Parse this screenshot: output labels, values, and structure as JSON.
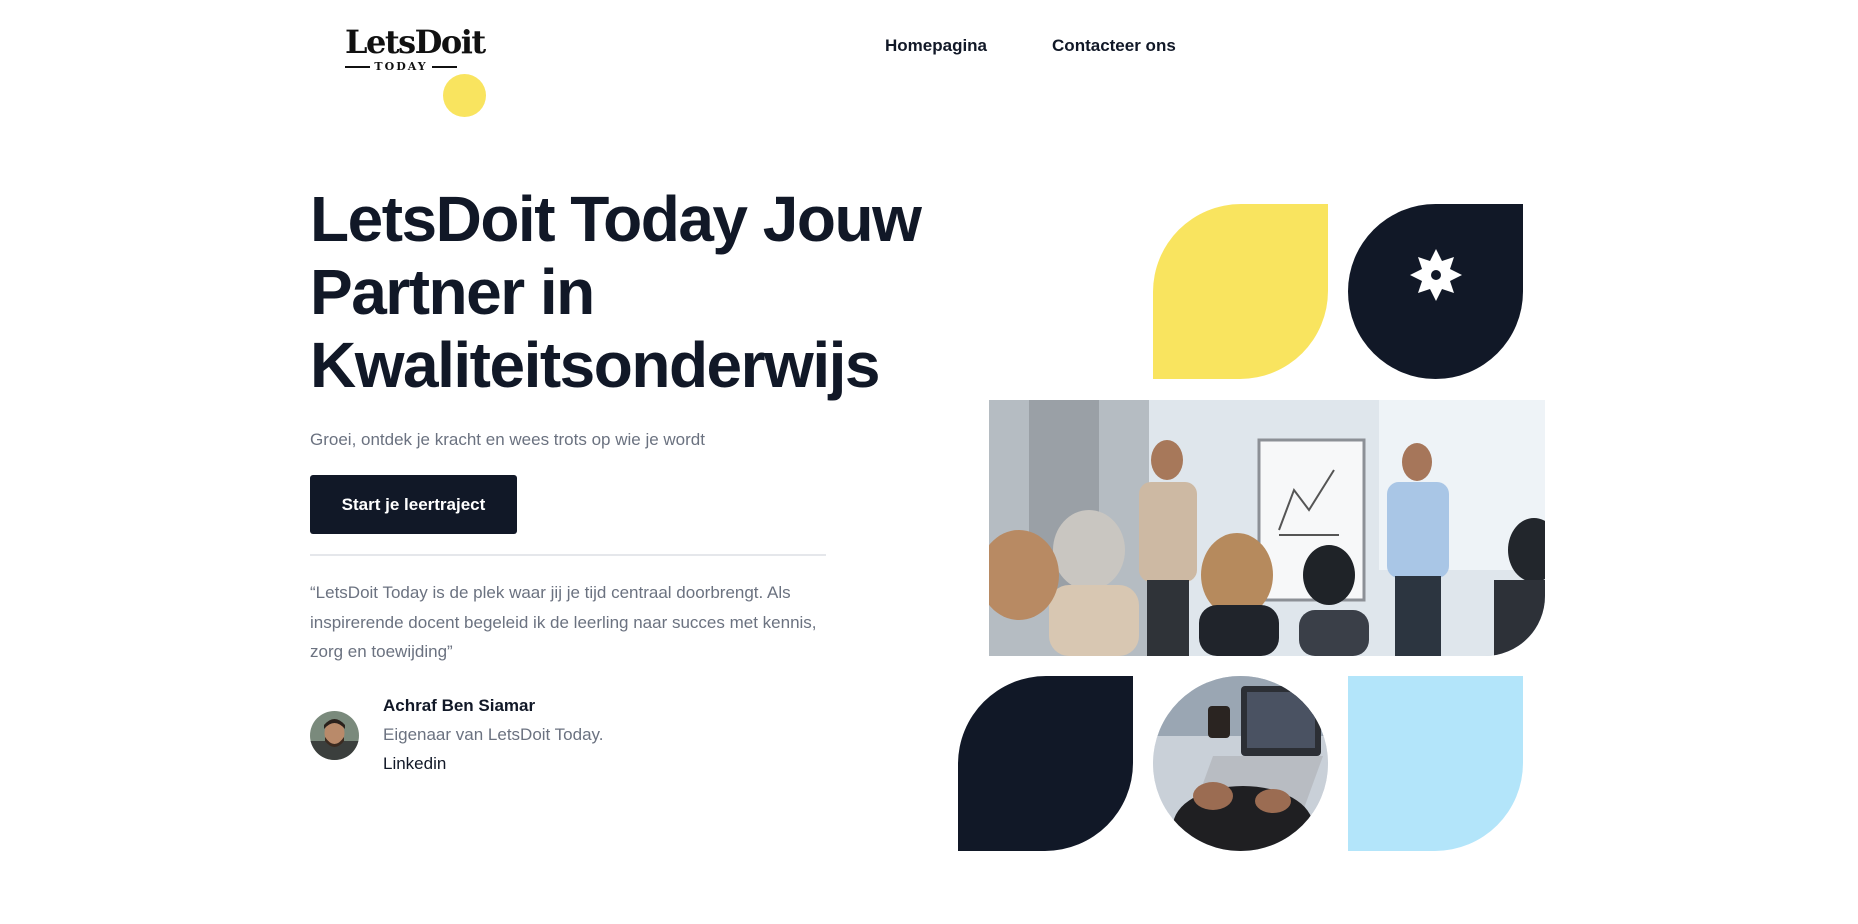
{
  "header": {
    "logo": {
      "word": "LetsDoit",
      "sub": "TODAY"
    },
    "nav": [
      {
        "label": "Homepagina"
      },
      {
        "label": "Contacteer ons"
      }
    ]
  },
  "hero": {
    "title": "LetsDoit Today Jouw Partner in Kwaliteitsonderwijs",
    "subtitle": "Groei, ontdek je kracht en wees trots op wie je wordt",
    "cta_label": "Start je leertraject",
    "quote": "“LetsDoit Today is de plek waar jij je tijd centraal doorbrengt. Als inspirerende docent begeleid ik de leerling naar succes met kennis, zorg en toewijding”",
    "author": {
      "name": "Achraf Ben Siamar",
      "role": "Eigenaar van LetsDoit Today.",
      "link": "Linkedin"
    }
  },
  "colors": {
    "navy": "#111827",
    "yellow": "#f9e45f",
    "light_blue": "#b3e5fa",
    "muted_text": "#6b7280"
  },
  "icons": [
    "star-burst-icon"
  ]
}
